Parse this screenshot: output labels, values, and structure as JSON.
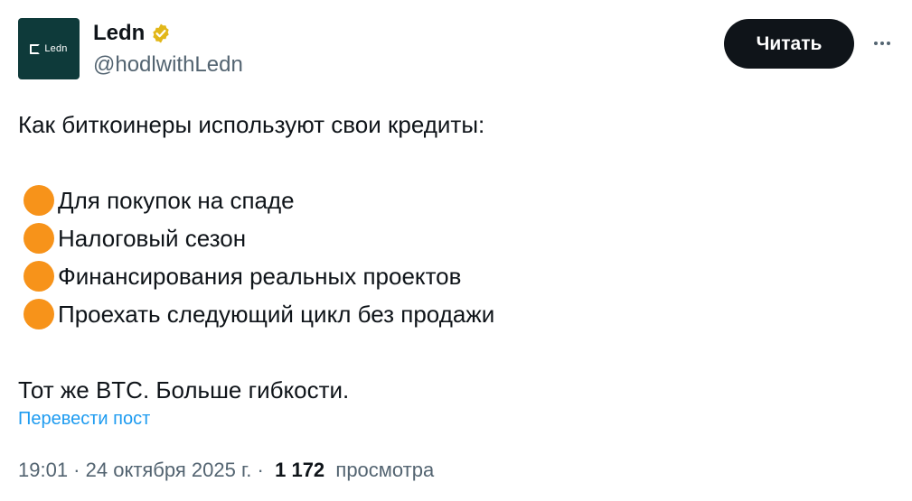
{
  "author": {
    "avatar_label": "Ledn",
    "display_name": "Ledn",
    "handle": "@hodlwithLedn",
    "verified_icon": "verified-gold-badge"
  },
  "actions": {
    "read_label": "Читать",
    "more_icon": "ellipsis-icon"
  },
  "tweet": {
    "intro": "Как биткоинеры используют свои кредиты:",
    "bullets": [
      "Для покупок на спаде",
      "Налоговый сезон",
      "Финансирования реальных проектов",
      "Проехать следующий цикл без продажи"
    ],
    "closing": "Тот же BTC. Больше гибкости.",
    "translate_label": "Перевести пост"
  },
  "meta": {
    "time": "19:01",
    "date": "24 октября 2025 г.",
    "views_count": "1 172",
    "views_label": "просмотра"
  },
  "colors": {
    "brand_bg": "#0e3a3a",
    "bullet_orange": "#f7931a",
    "verified_gold": "#e2b719",
    "link_blue": "#1d9bf0"
  }
}
